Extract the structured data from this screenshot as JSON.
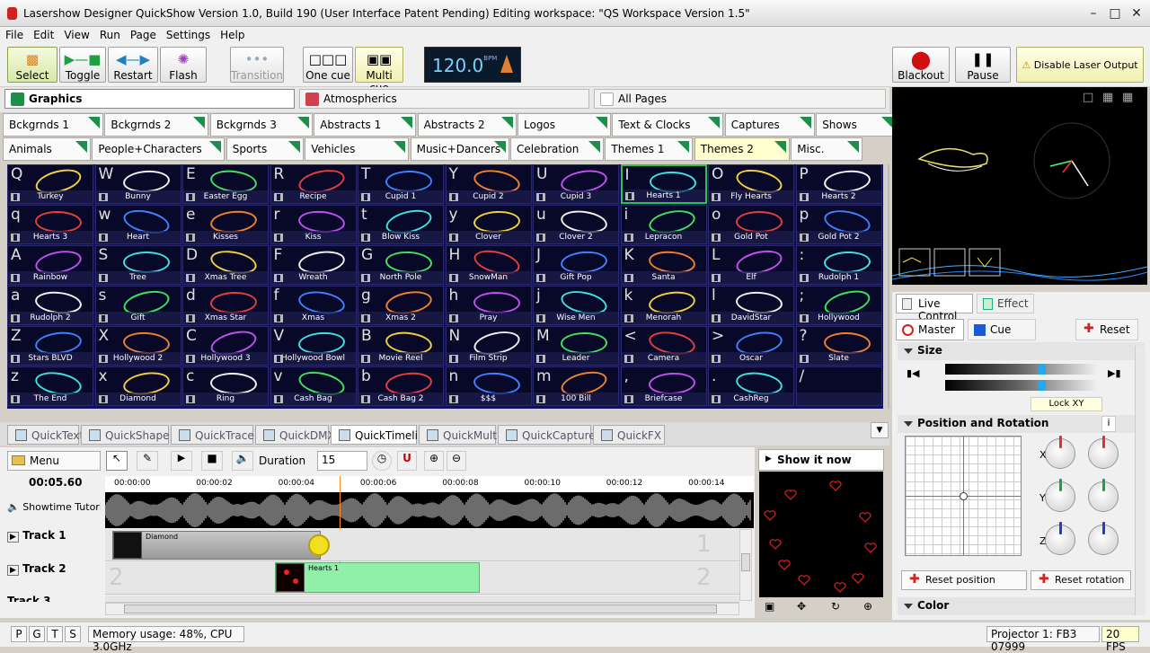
{
  "app": {
    "title": "Lasershow Designer QuickShow   Version 1.0, Build 190   (User Interface Patent Pending)   Editing workspace: \"QS Workspace Version 1.5\""
  },
  "menu": [
    "File",
    "Edit",
    "View",
    "Run",
    "Page",
    "Settings",
    "Help"
  ],
  "toolbar": {
    "select": "Select",
    "toggle": "Toggle",
    "restart": "Restart",
    "flash": "Flash",
    "transition": "Transition",
    "one_cue": "One cue",
    "multi_cue": "Multi cue",
    "bpm": "120.0",
    "bpm_unit": "BPM",
    "blackout": "Blackout",
    "pause": "Pause",
    "disable": "Disable Laser Output"
  },
  "pages": {
    "graphics": "Graphics",
    "atmospherics": "Atmospherics",
    "all": "All Pages",
    "colors": {
      "graphics": "#1e8f4a",
      "atmospherics": "#d04050",
      "all": "#ffffff"
    }
  },
  "categories_row1": [
    "Bckgrnds 1",
    "Bckgrnds 2",
    "Bckgrnds 3",
    "Abstracts 1",
    "Abstracts 2",
    "Logos",
    "Text & Clocks",
    "Captures",
    "Shows"
  ],
  "categories_row2": [
    "Animals",
    "People+Characters",
    "Sports",
    "Vehicles",
    "Music+Dancers",
    "Celebration",
    "Themes 1",
    "Themes 2",
    "Misc."
  ],
  "active_category": "Themes 2",
  "cues": [
    [
      [
        "Q",
        "Turkey"
      ],
      [
        "W",
        "Bunny"
      ],
      [
        "E",
        "Easter Egg"
      ],
      [
        "R",
        "Recipe"
      ],
      [
        "T",
        "Cupid 1"
      ],
      [
        "Y",
        "Cupid 2"
      ],
      [
        "U",
        "Cupid 3"
      ],
      [
        "I",
        "Hearts 1"
      ],
      [
        "O",
        "Fly Hearts"
      ],
      [
        "P",
        "Hearts 2"
      ]
    ],
    [
      [
        "q",
        "Hearts 3"
      ],
      [
        "w",
        "Heart"
      ],
      [
        "e",
        "Kisses"
      ],
      [
        "r",
        "Kiss"
      ],
      [
        "t",
        "Blow Kiss"
      ],
      [
        "y",
        "Clover"
      ],
      [
        "u",
        "Clover 2"
      ],
      [
        "i",
        "Lepracon"
      ],
      [
        "o",
        "Gold Pot"
      ],
      [
        "p",
        "Gold Pot 2"
      ]
    ],
    [
      [
        "A",
        "Rainbow"
      ],
      [
        "S",
        "Tree"
      ],
      [
        "D",
        "Xmas Tree"
      ],
      [
        "F",
        "Wreath"
      ],
      [
        "G",
        "North Pole"
      ],
      [
        "H",
        "SnowMan"
      ],
      [
        "J",
        "Gift Pop"
      ],
      [
        "K",
        "Santa"
      ],
      [
        "L",
        "Elf"
      ],
      [
        ":",
        "Rudolph 1"
      ]
    ],
    [
      [
        "a",
        "Rudolph 2"
      ],
      [
        "s",
        "Gift"
      ],
      [
        "d",
        "Xmas Star"
      ],
      [
        "f",
        "Xmas"
      ],
      [
        "g",
        "Xmas 2"
      ],
      [
        "h",
        "Pray"
      ],
      [
        "j",
        "Wise Men"
      ],
      [
        "k",
        "Menorah"
      ],
      [
        "l",
        "DavidStar"
      ],
      [
        ";",
        "Hollywood"
      ]
    ],
    [
      [
        "Z",
        "Stars BLVD"
      ],
      [
        "X",
        "Hollywood 2"
      ],
      [
        "C",
        "Hollywood 3"
      ],
      [
        "V",
        "Hollywood Bowl"
      ],
      [
        "B",
        "Movie Reel"
      ],
      [
        "N",
        "Film Strip"
      ],
      [
        "M",
        "Leader"
      ],
      [
        "<",
        "Camera"
      ],
      [
        ">",
        "Oscar"
      ],
      [
        "?",
        "Slate"
      ]
    ],
    [
      [
        "z",
        "The End"
      ],
      [
        "x",
        "Diamond"
      ],
      [
        "c",
        "Ring"
      ],
      [
        "v",
        "Cash Bag"
      ],
      [
        "b",
        "Cash Bag 2"
      ],
      [
        "n",
        "$$$"
      ],
      [
        "m",
        "100 Bill"
      ],
      [
        ",",
        "Briefcase"
      ],
      [
        ".",
        "CashReg"
      ],
      [
        "/",
        ""
      ]
    ]
  ],
  "active_cue": "Hearts 1",
  "quicktabs": [
    "QuickText",
    "QuickShape",
    "QuickTrace",
    "QuickDMX",
    "QuickTimeline",
    "QuickMulti",
    "QuickCapture",
    "QuickFX"
  ],
  "active_quicktab": "QuickTimeline",
  "timeline": {
    "menu": "Menu",
    "duration_label": "Duration",
    "duration": "15",
    "time": "00:05.60",
    "audio": "Showtime Tutorial",
    "ticks": [
      "00:00:00",
      "00:00:02",
      "00:00:04",
      "00:00:06",
      "00:00:08",
      "00:00:10",
      "00:00:12",
      "00:00:14"
    ],
    "tracks": [
      "Track 1",
      "Track 2",
      "Track 3"
    ],
    "clips": [
      "Diamond",
      "Hearts 1"
    ],
    "track_numbers": [
      "1",
      "2"
    ]
  },
  "preview": {
    "show_now": "Show it now"
  },
  "right": {
    "live_control": "Live Control",
    "effect": "Effect",
    "master": "Master",
    "cue": "Cue",
    "reset": "Reset",
    "size": "Size",
    "lock": "Lock XY",
    "position": "Position and Rotation",
    "info": "i",
    "axes": [
      "X",
      "Y",
      "Z"
    ],
    "reset_position": "Reset position",
    "reset_rotation": "Reset rotation",
    "color": "Color"
  },
  "status": {
    "letters": [
      "P",
      "G",
      "T",
      "S"
    ],
    "memory": "Memory usage: 48%, CPU 3.0GHz",
    "projector": "Projector 1: FB3 07999",
    "fps": "20 FPS"
  }
}
